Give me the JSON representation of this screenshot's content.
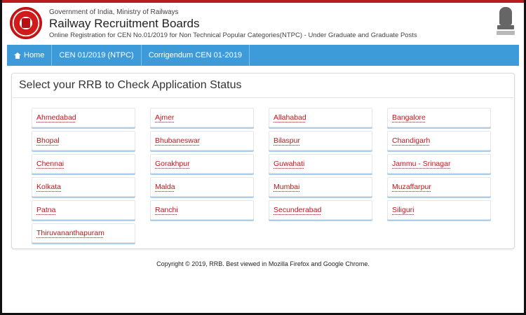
{
  "header": {
    "gov_line": "Government of India, Ministry of Railways",
    "title": "Railway Recruitment Boards",
    "subtitle": "Online Registration for CEN No.01/2019 for Non Technical Popular Categories(NTPC) - Under Graduate and Graduate Posts",
    "logo_icon": "indian-railways-logo",
    "emblem_icon": "national-emblem"
  },
  "nav": {
    "home_label": "Home",
    "home_icon": "home-icon",
    "items": [
      "CEN 01/2019 (NTPC)",
      "Corrigendum CEN 01-2019"
    ],
    "color": "#3d9bd9"
  },
  "panel": {
    "title": "Select your RRB to Check Application Status"
  },
  "rrbs": [
    "Ahmedabad",
    "Ajmer",
    "Allahabad",
    "Bangalore",
    "Bhopal",
    "Bhubaneswar",
    "Bilaspur",
    "Chandigarh",
    "Chennai",
    "Gorakhpur",
    "Guwahati",
    "Jammu - Srinagar",
    "Kolkata",
    "Malda",
    "Mumbai",
    "Muzaffarpur",
    "Patna",
    "Ranchi",
    "Secunderabad",
    "Siliguri",
    "Thiruvananthapuram"
  ],
  "link_color": "#c0161c",
  "footer": {
    "text": "Copyright © 2019, RRB. Best viewed in Mozilla Firefox and Google Chrome."
  }
}
